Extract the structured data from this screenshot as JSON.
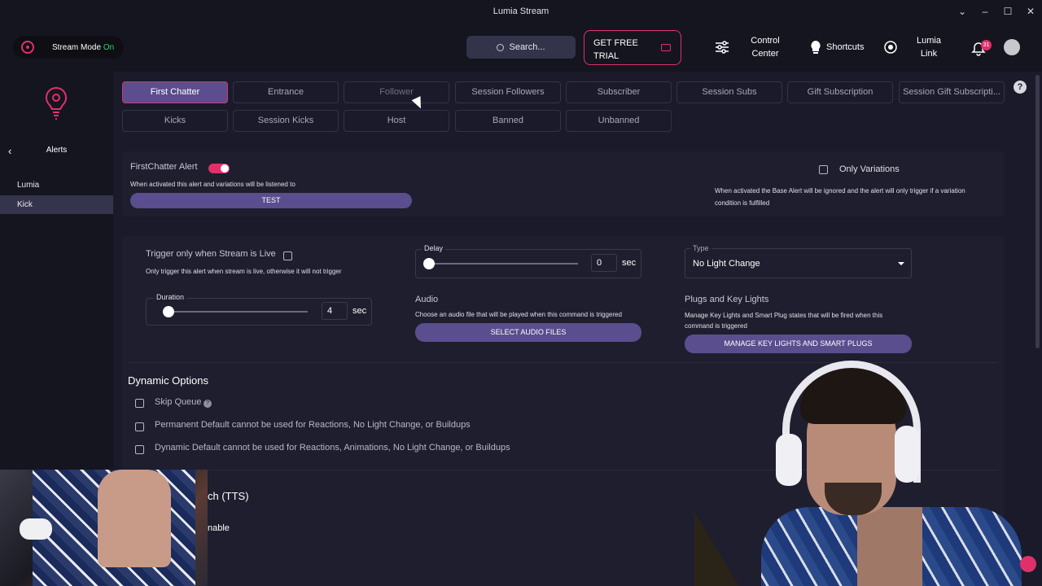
{
  "window": {
    "title": "Lumia Stream"
  },
  "header": {
    "stream_mode_label": "Stream Mode",
    "stream_mode_state": "On",
    "search_label": "Search...",
    "trial_label": "GET FREE TRIAL",
    "control_center_label": "Control Center",
    "shortcuts_label": "Shortcuts",
    "lumia_link_label": "Lumia Link",
    "notification_count": "31"
  },
  "sidebar": {
    "back_icon": "chevron-left-icon",
    "title": "Alerts",
    "items": [
      {
        "label": "Lumia",
        "active": false
      },
      {
        "label": "Kick",
        "active": true
      }
    ]
  },
  "tabs": {
    "row1": [
      "First Chatter",
      "Entrance",
      "Follower",
      "Session Followers",
      "Subscriber",
      "Session Subs",
      "Gift Subscription",
      "Session Gift Subscripti..."
    ],
    "row2": [
      "Kicks",
      "Session Kicks",
      "Host",
      "Banned",
      "Unbanned"
    ],
    "active": "First Chatter"
  },
  "alert_panel": {
    "title": "FirstChatter Alert",
    "toggle_on": true,
    "description": "When activated this alert and variations will be listened to",
    "test_label": "TEST",
    "only_variations_label": "Only Variations",
    "only_variations_desc": "When activated the Base Alert will be ignored and the alert will only trigger if a variation condition is fulfilled"
  },
  "settings": {
    "trigger_live_label": "Trigger only when Stream is Live",
    "trigger_live_desc": "Only trigger this alert when stream is live, otherwise it will not trigger",
    "duration_label": "Duration",
    "duration_value": "4",
    "duration_unit": "sec",
    "delay_label": "Delay",
    "delay_value": "0",
    "delay_unit": "sec",
    "type_label": "Type",
    "type_value": "No Light Change",
    "audio_label": "Audio",
    "audio_desc": "Choose an audio file that will be played when this command is triggered",
    "audio_button": "SELECT AUDIO FILES",
    "plugs_label": "Plugs and Key Lights",
    "plugs_desc": "Manage Key Lights and Smart Plug states that will be fired when this command is triggered",
    "plugs_button": "MANAGE KEY LIGHTS AND SMART PLUGS"
  },
  "dynamic_options": {
    "title": "Dynamic Options",
    "skip_queue": "Skip Queue",
    "permanent_default": "Permanent Default cannot be used for Reactions, No Light Change, or Buildups",
    "dynamic_default": "Dynamic Default cannot be used for Reactions, Animations, No Light Change, or Buildups"
  },
  "tts": {
    "title_visible": "ch (TTS)",
    "enable_visible": "nable"
  },
  "colors": {
    "accent": "#e0306a",
    "purple": "#5a4e8e",
    "bg": "#1a1a2a",
    "panel": "#1e1e2e",
    "status_on": "#32d26a"
  }
}
